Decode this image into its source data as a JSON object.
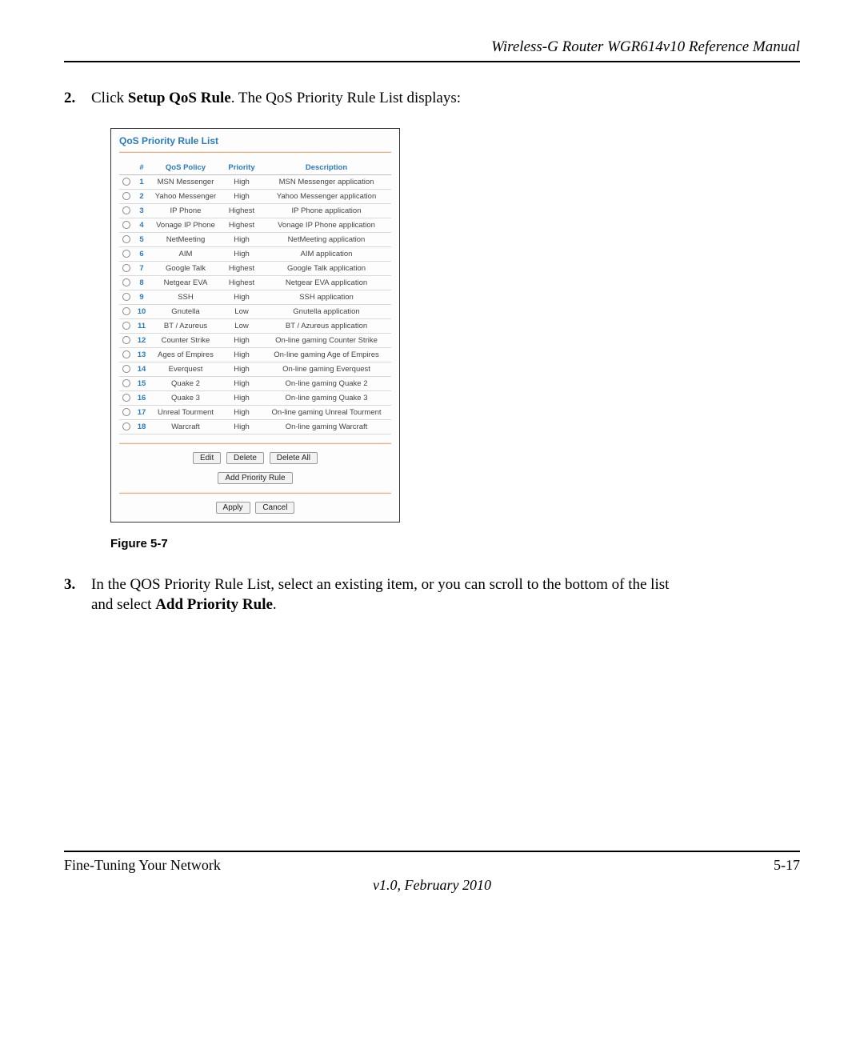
{
  "header": {
    "title": "Wireless-G Router WGR614v10 Reference Manual"
  },
  "step2": {
    "number": "2.",
    "prefix": "Click ",
    "bold": "Setup QoS Rule",
    "suffix": ". The QoS Priority Rule List displays:"
  },
  "panel": {
    "title": "QoS Priority Rule List",
    "headers": {
      "hash": "#",
      "policy": "QoS Policy",
      "priority": "Priority",
      "description": "Description"
    },
    "rows": [
      {
        "n": "1",
        "policy": "MSN Messenger",
        "priority": "High",
        "desc": "MSN Messenger application"
      },
      {
        "n": "2",
        "policy": "Yahoo Messenger",
        "priority": "High",
        "desc": "Yahoo Messenger application"
      },
      {
        "n": "3",
        "policy": "IP Phone",
        "priority": "Highest",
        "desc": "IP Phone application"
      },
      {
        "n": "4",
        "policy": "Vonage IP Phone",
        "priority": "Highest",
        "desc": "Vonage IP Phone application"
      },
      {
        "n": "5",
        "policy": "NetMeeting",
        "priority": "High",
        "desc": "NetMeeting application"
      },
      {
        "n": "6",
        "policy": "AIM",
        "priority": "High",
        "desc": "AIM application"
      },
      {
        "n": "7",
        "policy": "Google Talk",
        "priority": "Highest",
        "desc": "Google Talk application"
      },
      {
        "n": "8",
        "policy": "Netgear EVA",
        "priority": "Highest",
        "desc": "Netgear EVA application"
      },
      {
        "n": "9",
        "policy": "SSH",
        "priority": "High",
        "desc": "SSH application"
      },
      {
        "n": "10",
        "policy": "Gnutella",
        "priority": "Low",
        "desc": "Gnutella application"
      },
      {
        "n": "11",
        "policy": "BT / Azureus",
        "priority": "Low",
        "desc": "BT / Azureus application"
      },
      {
        "n": "12",
        "policy": "Counter Strike",
        "priority": "High",
        "desc": "On-line gaming Counter Strike"
      },
      {
        "n": "13",
        "policy": "Ages of Empires",
        "priority": "High",
        "desc": "On-line gaming Age of Empires"
      },
      {
        "n": "14",
        "policy": "Everquest",
        "priority": "High",
        "desc": "On-line gaming Everquest"
      },
      {
        "n": "15",
        "policy": "Quake 2",
        "priority": "High",
        "desc": "On-line gaming Quake 2"
      },
      {
        "n": "16",
        "policy": "Quake 3",
        "priority": "High",
        "desc": "On-line gaming Quake 3"
      },
      {
        "n": "17",
        "policy": "Unreal Tourment",
        "priority": "High",
        "desc": "On-line gaming Unreal Tourment"
      },
      {
        "n": "18",
        "policy": "Warcraft",
        "priority": "High",
        "desc": "On-line gaming Warcraft"
      }
    ],
    "buttons": {
      "edit": "Edit",
      "delete": "Delete",
      "deleteAll": "Delete All",
      "addPriority": "Add Priority Rule",
      "apply": "Apply",
      "cancel": "Cancel"
    }
  },
  "figureCaption": "Figure 5-7",
  "step3": {
    "number": "3.",
    "line1_a": "In the QOS Priority Rule List, select an existing item, or you can scroll to the bottom of the list",
    "line2_a": "and select ",
    "line2_b": "Add Priority Rule",
    "line2_c": "."
  },
  "footer": {
    "left": "Fine-Tuning Your Network",
    "right": "5-17",
    "version": "v1.0, February 2010"
  }
}
